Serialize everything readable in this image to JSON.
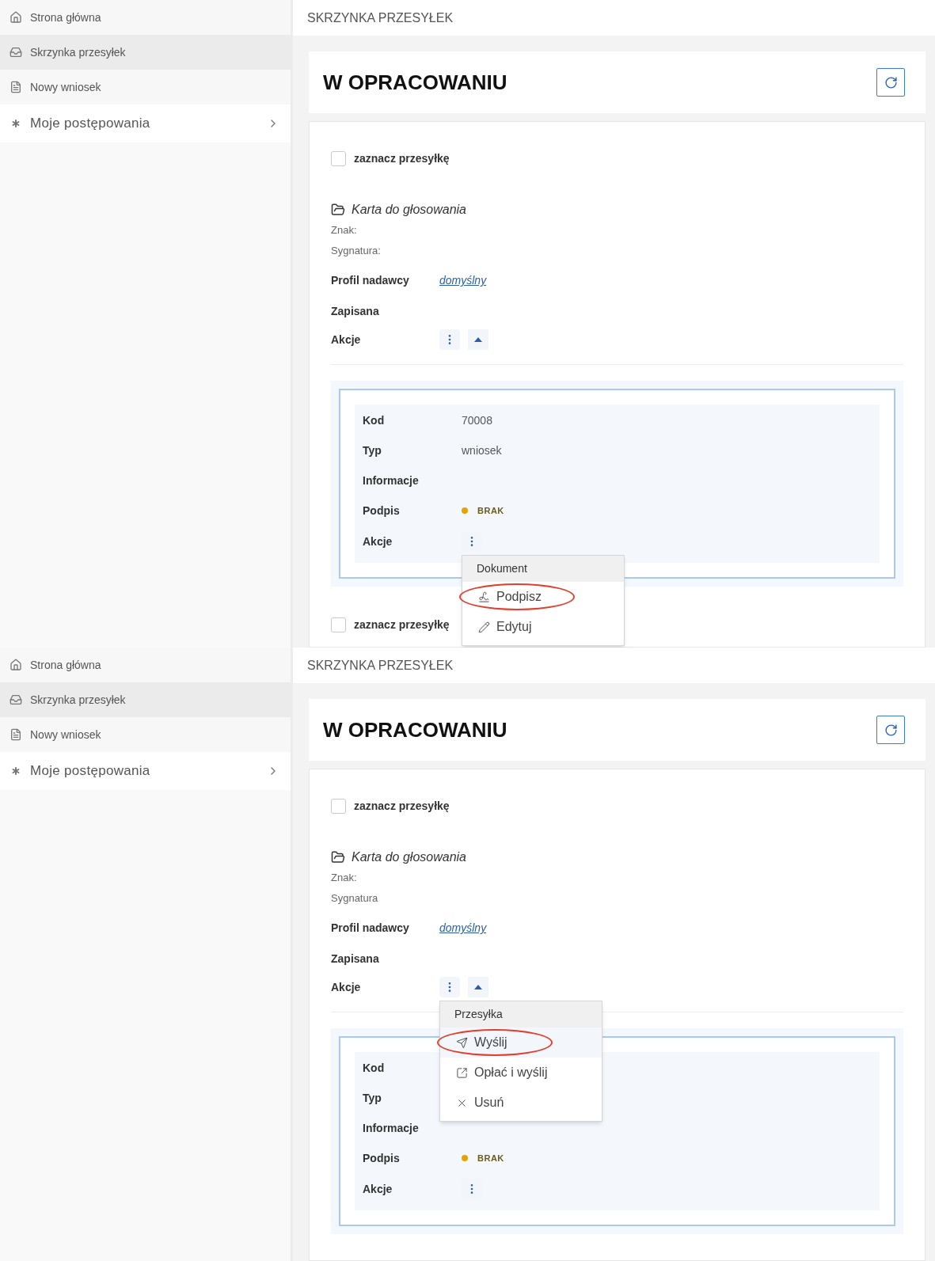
{
  "panels": [
    {
      "sidebar": [
        {
          "label": "Strona główna",
          "kind": "link",
          "selected": false
        },
        {
          "label": "Skrzynka przesyłek",
          "kind": "link",
          "selected": true
        },
        {
          "label": "Nowy wniosek",
          "kind": "link",
          "selected": false
        },
        {
          "label": "Moje postępowania",
          "kind": "group",
          "selected": false
        }
      ],
      "breadcrumb": "SKRZYNKA PRZESYŁEK",
      "title": "W OPRACOWANIU",
      "entry": {
        "select_label": "zaznacz przesyłkę",
        "checked": false,
        "name": "Karta do głosowania",
        "sign_label": "Znak:",
        "signature_label": "Sygnatura:",
        "profile_label": "Profil nadawcy",
        "profile_value": "domyślny",
        "status": "Zapisana",
        "actions_label": "Akcje",
        "expanded": true,
        "rows": [
          {
            "kind": "text",
            "label": "Kod",
            "value": "70008"
          },
          {
            "kind": "text",
            "label": "Typ",
            "value": "wniosek"
          },
          {
            "kind": "text",
            "label": "Informacje"
          },
          {
            "kind": "status",
            "label": "Podpis",
            "value": "BRAK",
            "color": "#e3a400"
          },
          {
            "kind": "actions",
            "label": "Akcje",
            "menu": {
              "header": "Dokument",
              "items": [
                {
                  "kind": "sign",
                  "label": "Podpisz",
                  "circled": true,
                  "selected": false
                },
                {
                  "kind": "edit",
                  "label": "Edytuj",
                  "circled": false,
                  "selected": false
                }
              ]
            }
          }
        ]
      },
      "next_entry": {
        "select_label": "zaznacz przesyłkę",
        "checked": false
      }
    },
    {
      "sidebar": [
        {
          "label": "Strona główna",
          "kind": "link",
          "selected": false
        },
        {
          "label": "Skrzynka przesyłek",
          "kind": "link",
          "selected": true
        },
        {
          "label": "Nowy wniosek",
          "kind": "link",
          "selected": false
        },
        {
          "label": "Moje postępowania",
          "kind": "group",
          "selected": false
        }
      ],
      "breadcrumb": "SKRZYNKA PRZESYŁEK",
      "title": "W OPRACOWANIU",
      "entry": {
        "select_label": "zaznacz przesyłkę",
        "checked": false,
        "name": "Karta do głosowania",
        "sign_label": "Znak:",
        "signature_label": "Sygnatura",
        "profile_label": "Profil nadawcy",
        "profile_value": "domyślny",
        "status": "Zapisana",
        "actions_label": "Akcje",
        "expanded": true,
        "menu": {
          "header": "Przesyłka",
          "items": [
            {
              "kind": "send",
              "label": "Wyślij",
              "circled": true,
              "selected": true
            },
            {
              "kind": "pay",
              "label": "Opłać i wyślij",
              "circled": false,
              "selected": false
            },
            {
              "kind": "delete",
              "label": "Usuń",
              "circled": false,
              "selected": false
            }
          ]
        },
        "rows": [
          {
            "kind": "text",
            "label": "Kod"
          },
          {
            "kind": "text",
            "label": "Typ"
          },
          {
            "kind": "text",
            "label": "Informacje"
          },
          {
            "kind": "status",
            "label": "Podpis",
            "value": "BRAK",
            "color": "#e3a400"
          },
          {
            "kind": "actions",
            "label": "Akcje"
          }
        ]
      }
    }
  ]
}
